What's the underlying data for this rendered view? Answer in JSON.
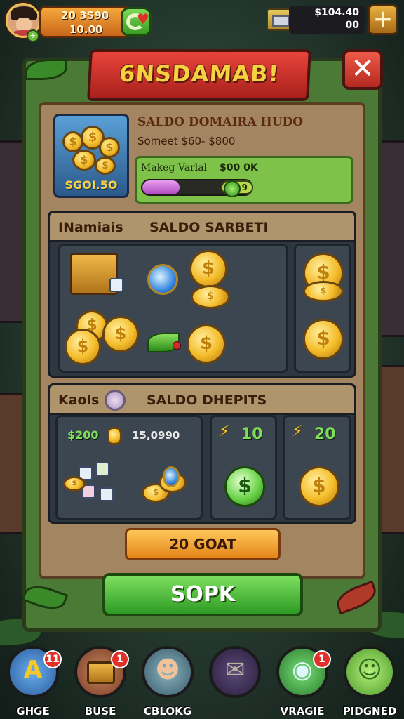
{
  "topbar": {
    "stat_line1": "20 3S90",
    "stat_line2": "10.00",
    "coins_line1": "$104.40",
    "coins_line2": "00",
    "plus_label": "+"
  },
  "dialog": {
    "title": "6NSDAMAB!",
    "close_label": "✕"
  },
  "bundle": {
    "thumb_label": "SGOI.5O",
    "title": "SALDO DOMAIRA HUDO",
    "subtitle": "Someet $60- $800",
    "progress_label": "Makeg Varlal",
    "progress_value": "$00 0K",
    "progress_fraction": 0.34,
    "progress_knob_text": "9"
  },
  "section1": {
    "title": "INamiais",
    "right_title": "SALDO SARBETI"
  },
  "section2": {
    "title": "Kaols",
    "right_title": "SALDO DHEPITS",
    "amount_green": "$200",
    "amount_white": "15,0990",
    "card2_amount": "10",
    "card3_amount": "20"
  },
  "buttons": {
    "orange": "20 GOAT",
    "green": "SOPK"
  },
  "nav": [
    {
      "label": "GHGE",
      "badge": "11",
      "color": "#3a8ad8"
    },
    {
      "label": "BUSE",
      "badge": "1",
      "color": "#a85a3a"
    },
    {
      "label": "CBLOKG",
      "badge": "",
      "color": "#4a7a8a"
    },
    {
      "label": "",
      "badge": "",
      "color": "#3a2e5a"
    },
    {
      "label": "VRAGIE",
      "badge": "1",
      "color": "#3aa04a"
    },
    {
      "label": "PIDGNED",
      "badge": "",
      "color": "#7ac84a"
    }
  ]
}
